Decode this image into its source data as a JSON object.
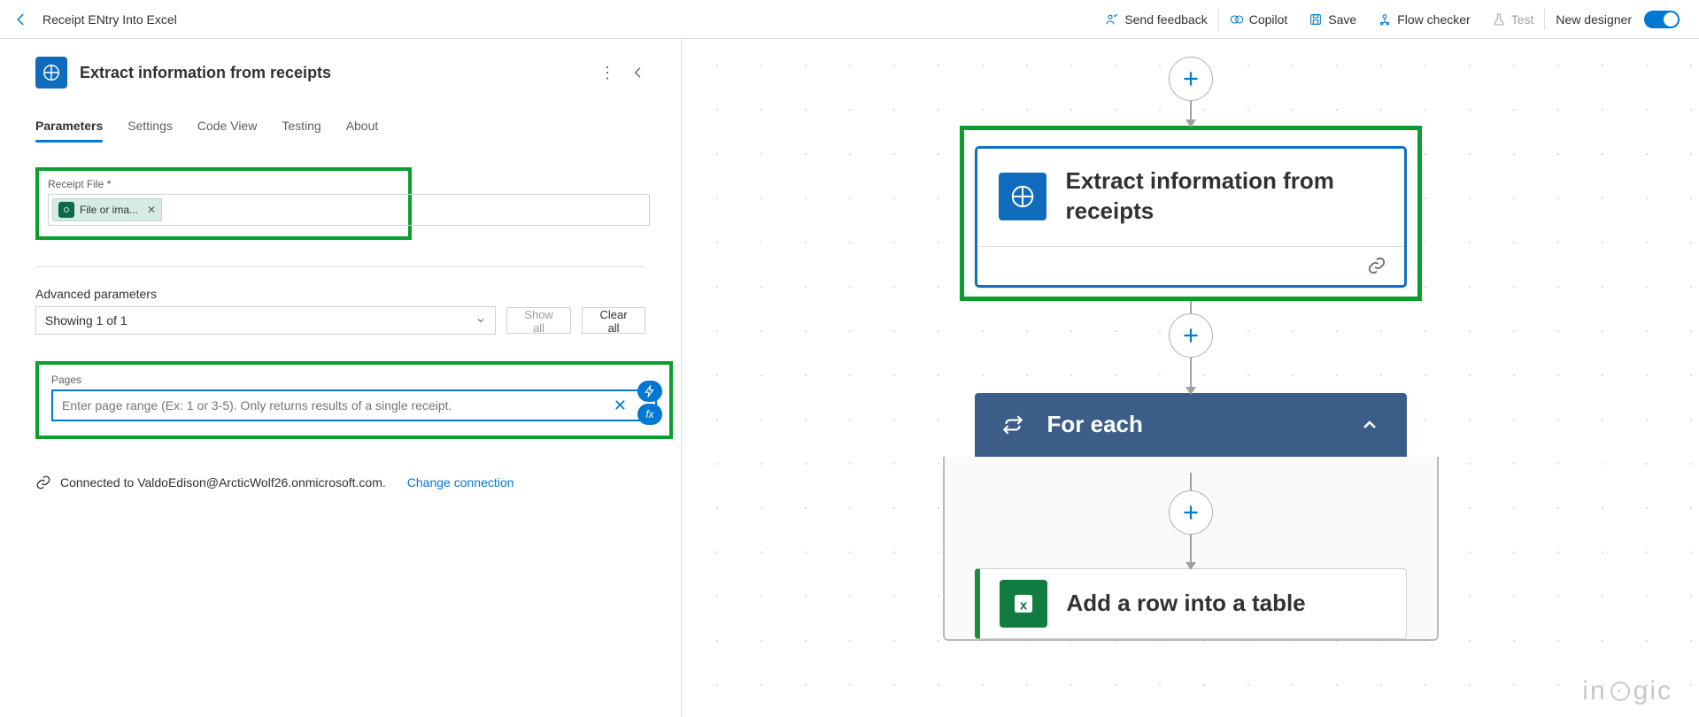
{
  "header": {
    "flow_title": "Receipt ENtry Into Excel",
    "actions": {
      "feedback": "Send feedback",
      "copilot": "Copilot",
      "save": "Save",
      "flow_checker": "Flow checker",
      "test": "Test",
      "new_designer": "New designer"
    }
  },
  "panel": {
    "title": "Extract information from receipts",
    "tabs": [
      "Parameters",
      "Settings",
      "Code View",
      "Testing",
      "About"
    ],
    "active_tab": 0,
    "receipt_file": {
      "label": "Receipt File",
      "required_mark": "*",
      "chip_text": "File or ima..."
    },
    "advanced": {
      "label": "Advanced parameters",
      "select_text": "Showing 1 of 1",
      "show_all": "Show all",
      "clear_all": "Clear all"
    },
    "pages": {
      "label": "Pages",
      "placeholder": "Enter page range (Ex: 1 or 3-5). Only returns results of a single receipt.",
      "value": ""
    },
    "connection": {
      "prefix": "Connected to",
      "account": "ValdoEdison@ArcticWolf26.onmicrosoft.com.",
      "change": "Change connection"
    }
  },
  "canvas": {
    "node1_title": "Extract information from receipts",
    "node2_title": "For each",
    "node3_title": "Add a row into a table"
  },
  "watermark": "inogic"
}
